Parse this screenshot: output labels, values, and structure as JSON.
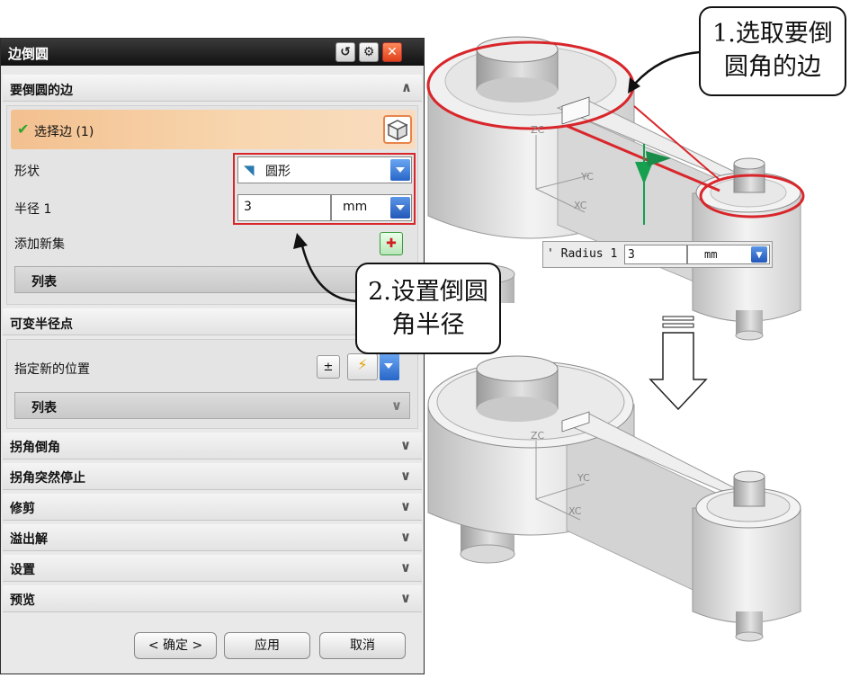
{
  "dialog": {
    "title": "边倒圆",
    "title_buttons": [
      "reset-icon",
      "gear-icon",
      "close-icon"
    ],
    "edge_section": {
      "header": "要倒圆的边",
      "select_edge": "选择边 (1)",
      "shape_label": "形状",
      "shape_value": "圆形",
      "radius_label": "半径 1",
      "radius_value": "3",
      "radius_unit": "mm",
      "add_set_label": "添加新集",
      "list_label": "列表"
    },
    "variable_section": {
      "header": "可变半径点",
      "specify_label": "指定新的位置",
      "list_label": "列表"
    },
    "collapsed_sections": [
      "拐角倒角",
      "拐角突然停止",
      "修剪",
      "溢出解",
      "设置",
      "预览"
    ],
    "buttons": {
      "ok": "< 确定 >",
      "apply": "应用",
      "cancel": "取消"
    }
  },
  "callouts": {
    "step1_line1": "1.选取要倒",
    "step1_line2": "圆角的边",
    "step2_line1": "2.设置倒圆",
    "step2_line2": "角半径"
  },
  "radius_popup": {
    "label": "Radius 1",
    "value": "3",
    "unit": "mm"
  },
  "viewport_labels": {
    "top_zc": "ZC",
    "top_yc": "YC",
    "top_xc": "XC",
    "bottom_zc": "ZC",
    "bottom_yc": "YC",
    "bottom_xc": "XC"
  },
  "colors": {
    "highlight": "#d8262b",
    "select_row": "#f3c08f",
    "accent_blue": "#2866c8"
  }
}
